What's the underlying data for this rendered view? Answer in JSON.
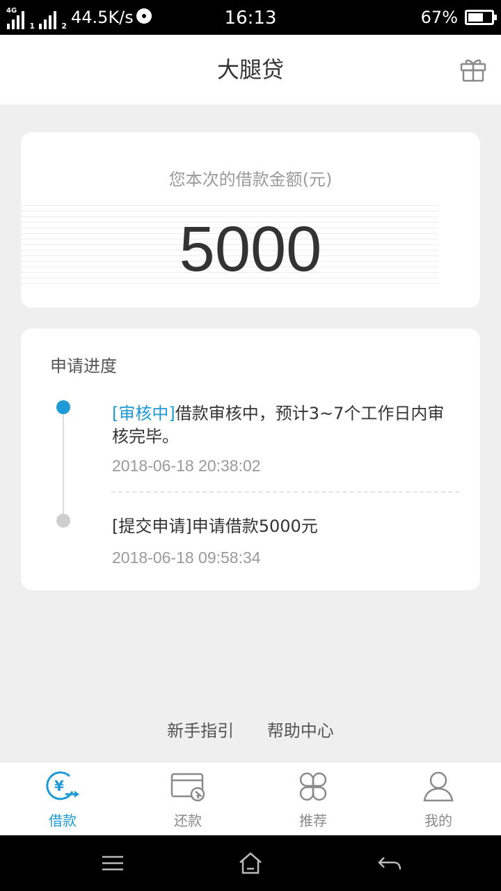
{
  "status_bar": {
    "network_1": "4G",
    "sim_1": "1",
    "sim_2": "2",
    "speed": "44.5K/s",
    "time": "16:13",
    "battery": "67%",
    "battery_level": 0.67
  },
  "header": {
    "title": "大腿贷",
    "right_icon": "gift-icon"
  },
  "amount_card": {
    "label": "您本次的借款金额(元)",
    "value": "5000"
  },
  "progress": {
    "title": "申请进度",
    "steps": [
      {
        "tag": "[审核中]",
        "text": "借款审核中，预计3~7个工作日内审核完毕。",
        "time": "2018-06-18 20:38:02",
        "color": "#1e9ad6"
      },
      {
        "tag": "[提交申请]",
        "text": "申请借款5000元",
        "time": "2018-06-18 09:58:34",
        "color": "#cfcfcf"
      }
    ]
  },
  "footer_links": {
    "guide": "新手指引",
    "help": "帮助中心"
  },
  "tabbar": {
    "tabs": [
      {
        "label": "借款",
        "icon": "yen-transfer-icon",
        "active": true
      },
      {
        "label": "还款",
        "icon": "card-cursor-icon",
        "active": false
      },
      {
        "label": "推荐",
        "icon": "four-circles-icon",
        "active": false
      },
      {
        "label": "我的",
        "icon": "user-icon",
        "active": false
      }
    ]
  },
  "nav_bar": {
    "menu_icon": "menu-icon",
    "home_icon": "home-icon",
    "back_icon": "back-icon"
  },
  "colors": {
    "accent": "#1e9ad6",
    "background": "#efefef"
  }
}
